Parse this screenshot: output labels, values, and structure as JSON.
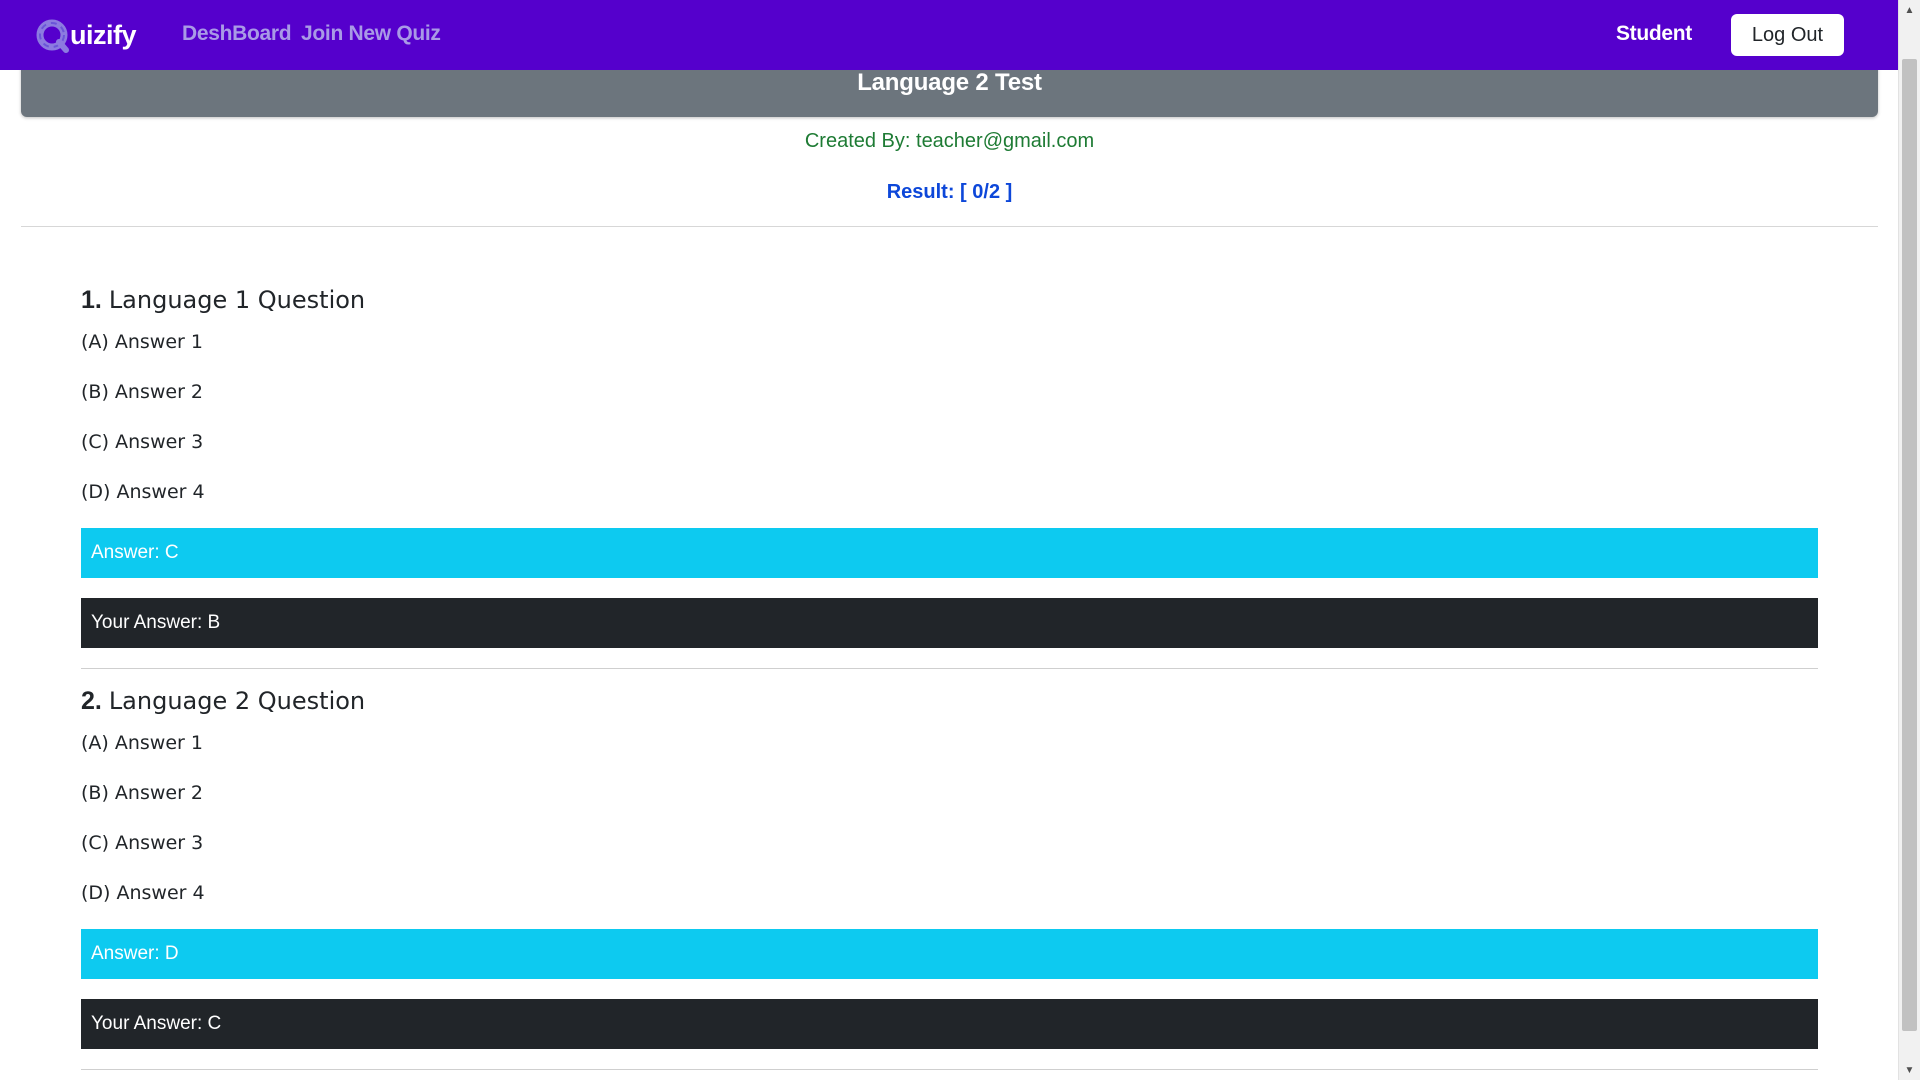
{
  "navbar": {
    "brand": "uizify",
    "brand_colors": {
      "bar": "#5500cc",
      "logo_ring": "#8c7be0",
      "links": "#a99ae6"
    },
    "links": [
      "DeshBoard",
      "Join New Quiz"
    ],
    "role": "Student",
    "logout_label": "Log Out"
  },
  "quiz": {
    "title": "Language 2 Test",
    "created_by": "Created By: teacher@gmail.com",
    "result": "Result: [ 0/2 ]"
  },
  "questions": [
    {
      "number": "1.",
      "text": "Language 1 Question",
      "options": [
        "(A) Answer 1",
        "(B) Answer 2",
        "(C) Answer 3",
        "(D) Answer 4"
      ],
      "answer": "Answer: C",
      "your_answer": "Your Answer: B"
    },
    {
      "number": "2.",
      "text": "Language 2 Question",
      "options": [
        "(A) Answer 1",
        "(B) Answer 2",
        "(C) Answer 3",
        "(D) Answer 4"
      ],
      "answer": "Answer: D",
      "your_answer": "Your Answer: C"
    }
  ],
  "colors": {
    "header_card": "#6c757d",
    "creator_text": "#1e7b34",
    "result_text": "#0d47d9",
    "answer_box": "#0dcaf0",
    "your_answer_box": "#212529"
  }
}
